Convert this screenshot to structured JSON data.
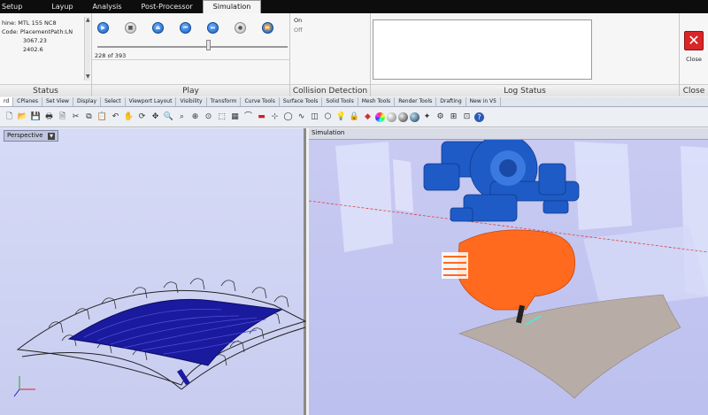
{
  "tabs": [
    {
      "label": "Setup",
      "active": false
    },
    {
      "label": "Layup",
      "active": false
    },
    {
      "label": "Analysis",
      "active": false
    },
    {
      "label": "Post-Processor",
      "active": false
    },
    {
      "label": "Simulation",
      "active": true
    }
  ],
  "status": {
    "label": "Status",
    "lines": [
      "hine:  MTL 155 NC8",
      "Code:  PlacementPath:LN",
      "3067.23",
      "2402.6"
    ]
  },
  "play": {
    "label": "Play",
    "counter": "228 of 393",
    "progress_fraction": 0.58
  },
  "collision": {
    "label": "Collision Detection",
    "on_label": "On",
    "off_label": "Off"
  },
  "log": {
    "label": "Log Status"
  },
  "close": {
    "label": "Close",
    "group_label": "Close"
  },
  "tool_tabs": [
    "rd",
    "CPlanes",
    "Set View",
    "Display",
    "Select",
    "Viewport Layout",
    "Visibility",
    "Transform",
    "Curve Tools",
    "Surface Tools",
    "Solid Tools",
    "Mesh Tools",
    "Render Tools",
    "Drafting",
    "New in V5"
  ],
  "viewports": {
    "left_title": "Perspective",
    "right_title": "Simulation"
  },
  "colors": {
    "robot_blue": "#1e5bc6",
    "head_orange": "#ff6a1e",
    "tape_blue": "#1a1a9e",
    "viewport_bg": "#c8ccf0"
  }
}
